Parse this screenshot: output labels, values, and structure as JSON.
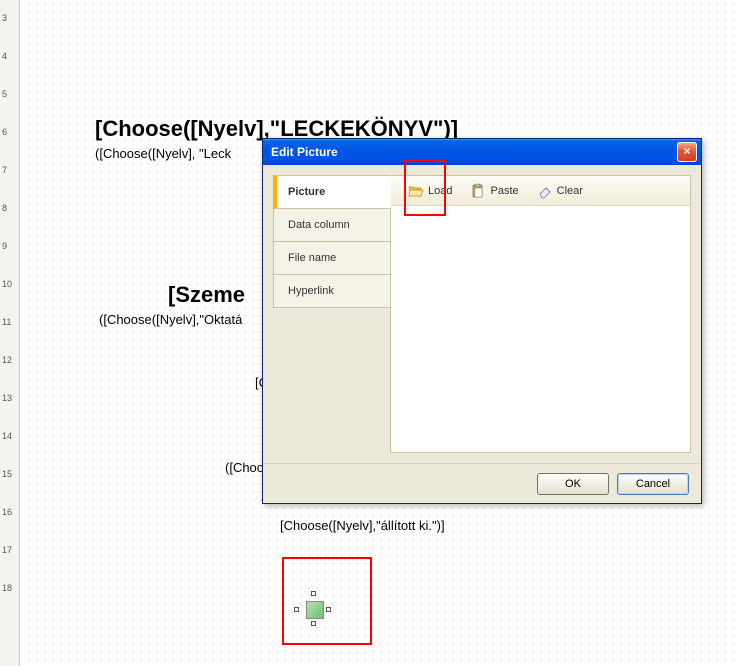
{
  "ruler": {
    "marks": [
      "3",
      "4",
      "5",
      "6",
      "7",
      "8",
      "9",
      "10",
      "11",
      "12",
      "13",
      "14",
      "15",
      "16",
      "17",
      "18"
    ]
  },
  "doc": {
    "line1": "[Choose([Nyelv],\"LECKEKÖNYV\")]",
    "line2": "([Choose([Nyelv], \"Leck",
    "line3": "[Szeme",
    "line4": "([Choose([Nyelv],\"Oktatá",
    "line5": "[C",
    "line6": "([Choo",
    "line7": "[Choose([Nyelv],\"állított ki.\")]"
  },
  "dialog": {
    "title": "Edit Picture",
    "close_glyph": "×",
    "categories": {
      "picture": "Picture",
      "data_column": "Data column",
      "file_name": "File name",
      "hyperlink": "Hyperlink"
    },
    "toolbar": {
      "load": "Load",
      "paste": "Paste",
      "clear": "Clear"
    },
    "buttons": {
      "ok": "OK",
      "cancel": "Cancel"
    }
  }
}
